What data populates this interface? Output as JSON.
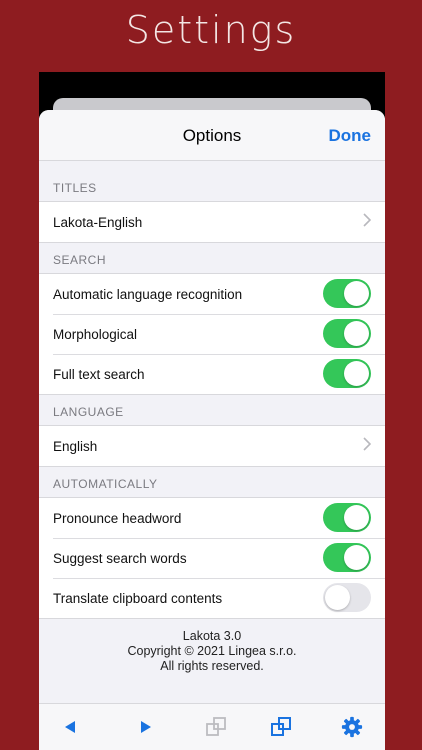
{
  "banner": {
    "title": "Settings"
  },
  "options": {
    "title": "Options",
    "done_label": "Done",
    "sections": {
      "titles": {
        "header": "TITLES",
        "items": [
          {
            "label": "Lakota-English"
          }
        ]
      },
      "search": {
        "header": "SEARCH",
        "items": [
          {
            "label": "Automatic language recognition",
            "on": true
          },
          {
            "label": "Morphological",
            "on": true
          },
          {
            "label": "Full text search",
            "on": true
          }
        ]
      },
      "language": {
        "header": "LANGUAGE",
        "items": [
          {
            "label": "English"
          }
        ]
      },
      "automatically": {
        "header": "AUTOMATICALLY",
        "items": [
          {
            "label": "Pronounce headword",
            "on": true
          },
          {
            "label": "Suggest search words",
            "on": true
          },
          {
            "label": "Translate clipboard contents",
            "on": false
          }
        ]
      }
    },
    "footer": {
      "version": "Lakota 3.0",
      "copyright": "Copyright © 2021 Lingea s.r.o.",
      "rights": "All rights reserved."
    }
  },
  "toolbar": {
    "icons": [
      "back-arrow-icon",
      "forward-arrow-icon",
      "copy-disabled-icon",
      "copy-icon",
      "gear-icon"
    ]
  },
  "colors": {
    "brand": "#8e1c20",
    "accent": "#1a73e0",
    "toggle_on": "#34c759"
  }
}
